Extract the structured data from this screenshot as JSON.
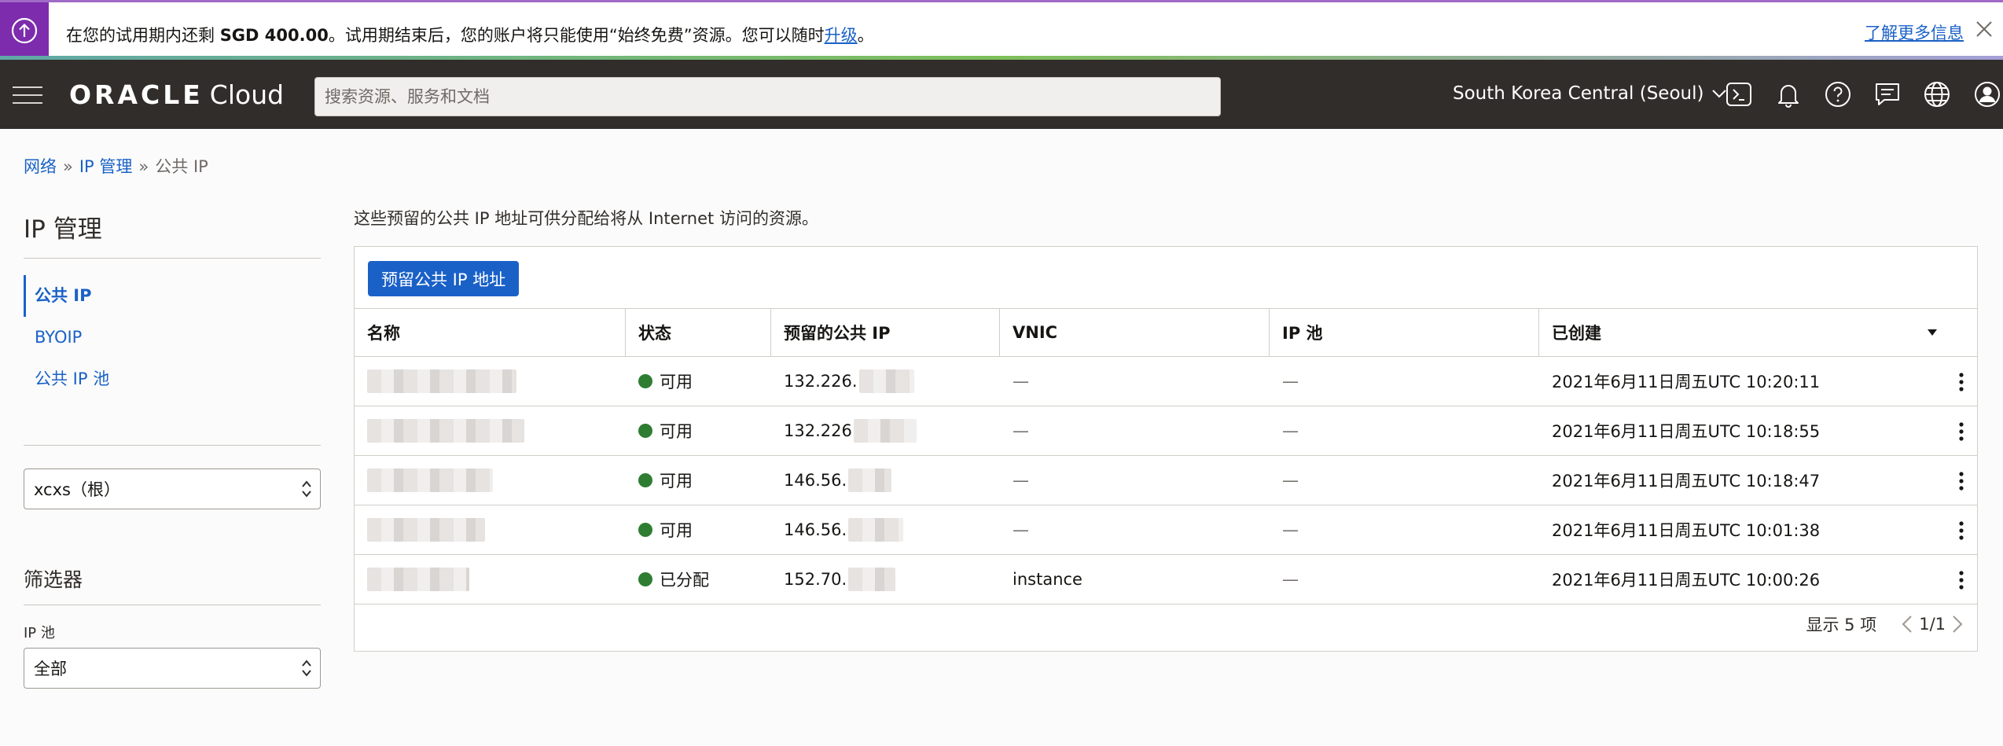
{
  "banner": {
    "text_pre": "在您的试用期内还剩 ",
    "amount": "SGD 400.00",
    "text_mid": "。试用期结束后，您的账户将只能使用“始终免费”资源。您可以随时",
    "upgrade_link": "升级",
    "text_end": "。",
    "learn_more": "了解更多信息"
  },
  "header": {
    "logo_oracle": "ORACLE",
    "logo_cloud": "Cloud",
    "search_placeholder": "搜索资源、服务和文档",
    "region": "South Korea Central (Seoul)"
  },
  "breadcrumb": {
    "items": [
      "网络",
      "IP 管理"
    ],
    "current": "公共 IP",
    "separator": "»"
  },
  "sidebar": {
    "title": "IP 管理",
    "items": [
      {
        "label": "公共 IP",
        "active": true
      },
      {
        "label": "BYOIP",
        "active": false
      },
      {
        "label": "公共 IP 池",
        "active": false
      }
    ],
    "compartment": "xcxs（根）",
    "filter_title": "筛选器",
    "ip_pool_label": "IP 池",
    "ip_pool_value": "全部"
  },
  "main": {
    "description": "这些预留的公共 IP 地址可供分配给将从 Internet 访问的资源。",
    "reserve_button": "预留公共 IP 地址",
    "columns": [
      "名称",
      "状态",
      "预留的公共 IP",
      "VNIC",
      "IP 池",
      "已创建"
    ],
    "rows": [
      {
        "status": "可用",
        "ip": "132.226.",
        "vnic": "—",
        "pool": "—",
        "created": "2021年6月11日周五UTC 10:20:11"
      },
      {
        "status": "可用",
        "ip": "132.226",
        "vnic": "—",
        "pool": "—",
        "created": "2021年6月11日周五UTC 10:18:55"
      },
      {
        "status": "可用",
        "ip": "146.56.",
        "vnic": "—",
        "pool": "—",
        "created": "2021年6月11日周五UTC 10:18:47"
      },
      {
        "status": "可用",
        "ip": "146.56.",
        "vnic": "—",
        "pool": "—",
        "created": "2021年6月11日周五UTC 10:01:38"
      },
      {
        "status": "已分配",
        "ip": "152.70.",
        "vnic": "instance",
        "pool": "—",
        "created": "2021年6月11日周五UTC 10:00:26"
      }
    ],
    "pager_summary": "显示 5 项",
    "pager_pages": "1/1"
  },
  "colors": {
    "accent": "#1a61c7",
    "header_bg": "#312d2a",
    "banner_icon_bg": "#7d2cad",
    "status_green": "#2e7d32"
  }
}
